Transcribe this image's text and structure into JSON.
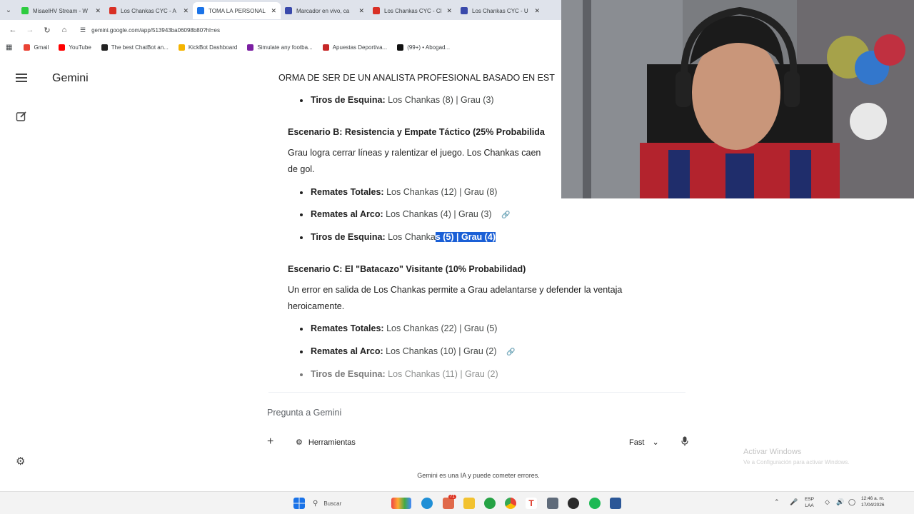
{
  "browser": {
    "tabs": [
      {
        "label": "MisaelHV Stream - W",
        "color": "#2ecc40",
        "active": false
      },
      {
        "label": "Los Chankas CYC - A",
        "color": "#d93025",
        "active": false
      },
      {
        "label": "TOMA LA PERSONAL",
        "color": "#1a73e8",
        "active": true
      },
      {
        "label": "Marcador en vivo, ca",
        "color": "#3949ab",
        "active": false
      },
      {
        "label": "Los Chankas CYC - Cl",
        "color": "#d93025",
        "active": false
      },
      {
        "label": "Los Chankas CYC - U",
        "color": "#3949ab",
        "active": false
      }
    ],
    "url": "gemini.google.com/app/513943ba06098b80?hl=es",
    "bookmarks": [
      {
        "label": "Gmail",
        "color": "#ea4335"
      },
      {
        "label": "YouTube",
        "color": "#ff0000"
      },
      {
        "label": "The best ChatBot an...",
        "color": "#222222"
      },
      {
        "label": "KickBot Dashboard",
        "color": "#f4b400"
      },
      {
        "label": "Simulate any footba...",
        "color": "#7b1fa2"
      },
      {
        "label": "Apuestas Deportiva...",
        "color": "#c62828"
      },
      {
        "label": "(99+) • Abogad...",
        "color": "#111111"
      }
    ]
  },
  "gemini": {
    "brand": "Gemini",
    "chat_title": "ORMA DE SER DE UN ANALISTA PROFESIONAL BASADO EN EST",
    "top_bullet": {
      "label": "Tiros de Esquina:",
      "value": "Los Chankas (8) | Grau (3)"
    },
    "scenario_b": {
      "heading": "Escenario B: Resistencia y Empate Táctico (25% Probabilida",
      "text_line1": "Grau logra cerrar líneas y ralentizar el juego. Los Chankas caen",
      "text_line2": "de gol.",
      "bullets": [
        {
          "label": "Remates Totales:",
          "value": "Los Chankas (12) | Grau (8)"
        },
        {
          "label": "Remates al Arco:",
          "value": "Los Chankas (4) | Grau (3)"
        },
        {
          "label": "Tiros de Esquina:",
          "value_plain": "Los Chanka",
          "value_highlight": "s (5) | Grau (4)"
        }
      ]
    },
    "scenario_c": {
      "heading": "Escenario C: El \"Batacazo\" Visitante (10% Probabilidad)",
      "text_line1": "Un error en salida de Los Chankas permite a Grau adelantarse y defender la ventaja",
      "text_line2": "heroicamente.",
      "bullets": [
        {
          "label": "Remates Totales:",
          "value": "Los Chankas (22) | Grau (5)"
        },
        {
          "label": "Remates al Arco:",
          "value": "Los Chankas (10) | Grau (2)"
        },
        {
          "label": "Tiros de Esquina:",
          "value": "Los Chankas (11) | Grau (2)"
        }
      ]
    },
    "prompt": {
      "placeholder": "Pregunta a Gemini",
      "tools_label": "Herramientas",
      "mode_label": "Fast"
    },
    "disclaimer": "Gemini es una IA y puede cometer errores."
  },
  "windows": {
    "watermark_title": "Activar Windows",
    "watermark_sub": "Ve a Configuración para activar Windows.",
    "search_placeholder": "Buscar",
    "badge_count": "71",
    "lang_top": "ESP",
    "lang_bottom": "LAA",
    "time": "12:46 a. m.",
    "date": "17/04/2026"
  }
}
